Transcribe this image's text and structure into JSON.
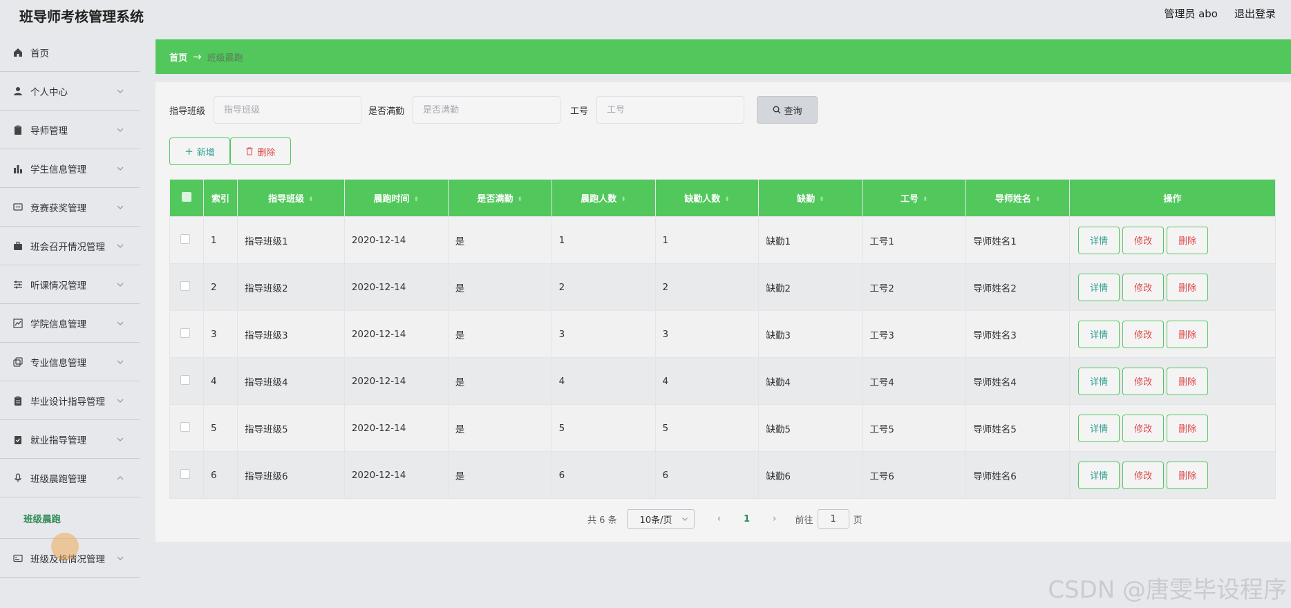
{
  "app": {
    "title": "班导师考核管理系统"
  },
  "header": {
    "user": "管理员 abo",
    "logout": "退出登录"
  },
  "sidebar": {
    "items": [
      {
        "label": "首页",
        "icon": "home-icon"
      },
      {
        "label": "个人中心",
        "icon": "user-icon"
      },
      {
        "label": "导师管理",
        "icon": "clipboard-icon"
      },
      {
        "label": "学生信息管理",
        "icon": "bar-chart-icon"
      },
      {
        "label": "竞赛获奖管理",
        "icon": "chat-icon"
      },
      {
        "label": "班会召开情况管理",
        "icon": "briefcase-icon"
      },
      {
        "label": "听课情况管理",
        "icon": "sliders-icon"
      },
      {
        "label": "学院信息管理",
        "icon": "line-chart-icon"
      },
      {
        "label": "专业信息管理",
        "icon": "copy-icon"
      },
      {
        "label": "毕业设计指导管理",
        "icon": "clipboard-icon"
      },
      {
        "label": "就业指导管理",
        "icon": "clipboard-check-icon"
      },
      {
        "label": "班级晨跑管理",
        "icon": "microphone-icon"
      },
      {
        "label": "班级晨跑",
        "icon": ""
      },
      {
        "label": "班级及格情况管理",
        "icon": "card-icon"
      }
    ]
  },
  "breadcrumb": {
    "home": "首页",
    "arrow": "→",
    "current": "班级晨跑"
  },
  "search": {
    "class_label": "指导班级",
    "class_placeholder": "指导班级",
    "full_label": "是否满勤",
    "full_placeholder": "是否满勤",
    "id_label": "工号",
    "id_placeholder": "工号",
    "query": "查询"
  },
  "actions": {
    "add": "新增",
    "delete": "删除"
  },
  "table": {
    "headers": [
      "索引",
      "指导班级",
      "晨跑时间",
      "是否满勤",
      "晨跑人数",
      "缺勤人数",
      "缺勤",
      "工号",
      "导师姓名",
      "操作"
    ],
    "rows": [
      [
        "1",
        "指导班级1",
        "2020-12-14",
        "是",
        "1",
        "1",
        "缺勤1",
        "工号1",
        "导师姓名1"
      ],
      [
        "2",
        "指导班级2",
        "2020-12-14",
        "是",
        "2",
        "2",
        "缺勤2",
        "工号2",
        "导师姓名2"
      ],
      [
        "3",
        "指导班级3",
        "2020-12-14",
        "是",
        "3",
        "3",
        "缺勤3",
        "工号3",
        "导师姓名3"
      ],
      [
        "4",
        "指导班级4",
        "2020-12-14",
        "是",
        "4",
        "4",
        "缺勤4",
        "工号4",
        "导师姓名4"
      ],
      [
        "5",
        "指导班级5",
        "2020-12-14",
        "是",
        "5",
        "5",
        "缺勤5",
        "工号5",
        "导师姓名5"
      ],
      [
        "6",
        "指导班级6",
        "2020-12-14",
        "是",
        "6",
        "6",
        "缺勤6",
        "工号6",
        "导师姓名6"
      ]
    ],
    "row_actions": {
      "detail": "详情",
      "edit": "修改",
      "delete": "删除"
    }
  },
  "pagination": {
    "total": "共 6 条",
    "page_size": "10条/页",
    "current": "1",
    "goto": "前往",
    "goto_value": "1",
    "page_unit": "页"
  },
  "watermark": "CSDN @唐雯毕设程序",
  "colors": {
    "accent": "#52c75c",
    "danger": "#e04848",
    "link": "#2f9e8f"
  }
}
